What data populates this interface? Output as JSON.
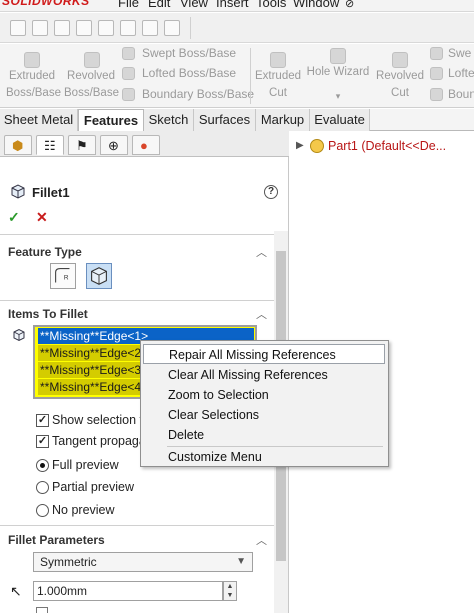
{
  "app": {
    "logo": "SOLIDWORKS",
    "menu": [
      "File",
      "Edit",
      "View",
      "Insert",
      "Tools",
      "Window"
    ]
  },
  "command_manager": {
    "extruded_boss": [
      "Extruded",
      "Boss/Base"
    ],
    "revolved_boss": [
      "Revolved",
      "Boss/Base"
    ],
    "swept_boss": "Swept Boss/Base",
    "lofted_boss": "Lofted Boss/Base",
    "boundary_boss": "Boundary Boss/Base",
    "extruded_cut": [
      "Extruded",
      "Cut"
    ],
    "hole_wizard": "Hole Wizard",
    "revolved_cut": [
      "Revolved",
      "Cut"
    ],
    "swept_cut": "Swe",
    "lofted_cut": "Lofte",
    "boundary_cut": "Boun"
  },
  "tabs": [
    {
      "label": "Sheet Metal",
      "active": false
    },
    {
      "label": "Features",
      "active": true
    },
    {
      "label": "Sketch",
      "active": false
    },
    {
      "label": "Surfaces",
      "active": false
    },
    {
      "label": "Markup",
      "active": false
    },
    {
      "label": "Evaluate",
      "active": false
    }
  ],
  "property_manager": {
    "title": "Fillet1",
    "help": "?",
    "ok": "✓",
    "cancel": "✕",
    "feature_type": {
      "heading": "Feature Type"
    },
    "items_to_fillet": {
      "heading": "Items To Fillet",
      "edges": [
        "**Missing**Edge<1>",
        "**Missing**Edge<2>",
        "**Missing**Edge<3>",
        "**Missing**Edge<4>"
      ],
      "options": [
        {
          "label": "Show selection toc",
          "checked": true
        },
        {
          "label": "Tangent propagati",
          "checked": true
        }
      ],
      "preview": [
        {
          "label": "Full preview",
          "selected": true
        },
        {
          "label": "Partial preview",
          "selected": false
        },
        {
          "label": "No preview",
          "selected": false
        }
      ]
    },
    "fillet_parameters": {
      "heading": "Fillet Parameters",
      "profile": "Symmetric",
      "radius": "1.000mm"
    }
  },
  "feature_tree": {
    "root": "Part1  (Default<<De..."
  },
  "context_menu": {
    "items": [
      {
        "label": "Repair All Missing References",
        "hover": true
      },
      {
        "label": "Clear All Missing References",
        "hover": false
      },
      {
        "label": "Zoom to Selection",
        "hover": false
      },
      {
        "label": "Clear Selections",
        "hover": false
      },
      {
        "label": "Delete",
        "hover": false
      },
      {
        "label": "Customize Menu",
        "hover": false
      }
    ]
  },
  "colors": {
    "accent_red": "#b81616",
    "selection_blue": "#0b63c7",
    "highlight_yellow": "#ffff00"
  }
}
